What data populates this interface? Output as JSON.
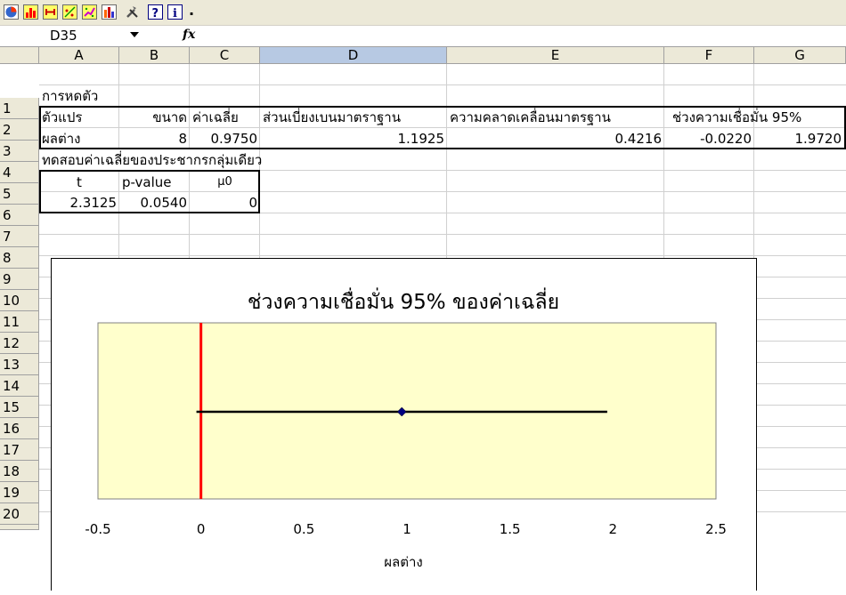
{
  "toolbar": {
    "buttons": [
      {
        "icon": "pie-chart-icon"
      },
      {
        "icon": "histogram-icon"
      },
      {
        "icon": "error-bar-icon"
      },
      {
        "icon": "scatter-icon"
      },
      {
        "icon": "regression-icon"
      },
      {
        "icon": "bar-chart-icon"
      },
      {
        "icon": "tools-icon"
      },
      {
        "icon": "help-icon"
      },
      {
        "icon": "info-icon"
      }
    ],
    "overflow_label": "."
  },
  "formula_bar": {
    "name_box": "D35",
    "fx_label": "fx",
    "formula": ""
  },
  "sheet": {
    "columns": [
      "A",
      "B",
      "C",
      "D",
      "E",
      "F",
      "G"
    ],
    "rows": [
      "1",
      "2",
      "3",
      "4",
      "5",
      "6",
      "7",
      "8",
      "9",
      "10",
      "11",
      "12",
      "13",
      "14",
      "15",
      "16",
      "17",
      "18",
      "19",
      "20"
    ],
    "cells": {
      "a1": "การหดตัว",
      "a2": "ตัวแปร",
      "b2": "ขนาด",
      "c2": "ค่าเฉลี่ย",
      "d2": "ส่วนเบี่ยงเบนมาตราฐาน",
      "e2": "ความคลาดเคลื่อนมาตรฐาน",
      "f2": "ช่วงความเชื่อมั่น 95%",
      "a3": "ผลต่าง",
      "b3": "8",
      "c3": "0.9750",
      "d3": "1.1925",
      "e3": "0.4216",
      "f3": "-0.0220",
      "g3": "1.9720",
      "a4": "ทดสอบค่าเฉลี่ยของประชากรกลุ่มเดียว",
      "a5": "t",
      "b5": "p-value",
      "c5": "μ0",
      "a6": "2.3125",
      "b6": "0.0540",
      "c6": "0"
    }
  },
  "chart_data": {
    "type": "scatter",
    "title": "ช่วงความเชื่อมั่น 95% ของค่าเฉลี่ย",
    "xlabel": "ผลต่าง",
    "ylabel": "",
    "xlim": [
      -0.5,
      2.5
    ],
    "xticks": [
      "-0.5",
      "0",
      "0.5",
      "1",
      "1.5",
      "2",
      "2.5"
    ],
    "point": {
      "x": 0.975
    },
    "interval": {
      "low": -0.022,
      "high": 1.972
    },
    "reference_line": {
      "x": 0
    },
    "colors": {
      "plot_background": "#ffffcc",
      "reference_line": "#ff0000",
      "marker": "#000080",
      "interval": "#000000"
    },
    "grid": false
  }
}
